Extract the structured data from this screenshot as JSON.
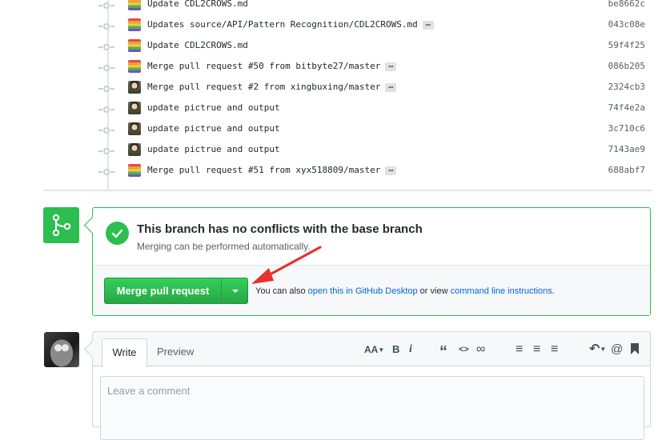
{
  "commits": [
    {
      "message": "Update CDL2CROWS.md",
      "sha": "be8662c",
      "avatar": "rainbow",
      "has_more": false
    },
    {
      "message": "Updates source/API/Pattern Recognition/CDL2CROWS.md",
      "sha": "043c08e",
      "avatar": "rainbow",
      "has_more": true
    },
    {
      "message": "Update CDL2CROWS.md",
      "sha": "59f4f25",
      "avatar": "rainbow",
      "has_more": false
    },
    {
      "message": "Merge pull request #50 from bitbyte27/master",
      "sha": "086b205",
      "avatar": "rainbow",
      "has_more": true
    },
    {
      "message": "Merge pull request #2 from xingbuxing/master",
      "sha": "2324cb3",
      "avatar": "person",
      "has_more": true
    },
    {
      "message": "update pictrue and output",
      "sha": "74f4e2a",
      "avatar": "person",
      "has_more": false
    },
    {
      "message": "update pictrue and output",
      "sha": "3c710c6",
      "avatar": "person",
      "has_more": false
    },
    {
      "message": "update pictrue and output",
      "sha": "7143ae9",
      "avatar": "person",
      "has_more": false
    },
    {
      "message": "Merge pull request #51 from xyx518809/master",
      "sha": "688abf7",
      "avatar": "rainbow",
      "has_more": true
    }
  ],
  "ellipsis_label": "…",
  "merge": {
    "title": "This branch has no conflicts with the base branch",
    "subtitle": "Merging can be performed automatically.",
    "button_label": "Merge pull request",
    "help_prefix": "You can also ",
    "help_link1": "open this in GitHub Desktop",
    "help_middle": " or view ",
    "help_link2": "command line instructions",
    "help_suffix": "."
  },
  "comment": {
    "tab_write": "Write",
    "tab_preview": "Preview",
    "placeholder": "Leave a comment",
    "toolbar": {
      "heading": "AA",
      "bold": "B",
      "italic": "i",
      "quote": "“",
      "code": "<>",
      "link": "∞",
      "bullet_list": "≡",
      "numbered_list": "≡",
      "task_list": "≡",
      "reply": "↶",
      "mention": "@",
      "saved_reply": "▮"
    }
  },
  "colors": {
    "success": "#2cbe4e",
    "link": "#0366d6",
    "annotation": "#e8312f"
  }
}
